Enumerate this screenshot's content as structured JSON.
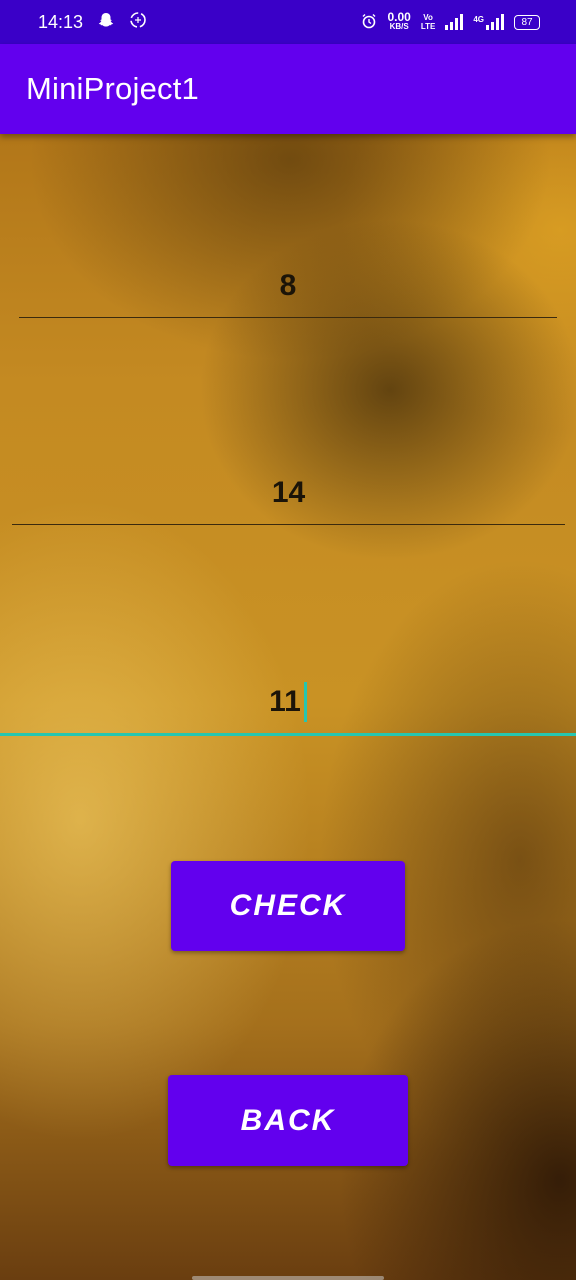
{
  "status_bar": {
    "time": "14:13",
    "speed_value": "0.00",
    "speed_unit": "KB/S",
    "volte_top": "Vo",
    "volte_bottom": "LTE",
    "network": "4G",
    "battery": "87",
    "icons": [
      "snapchat-icon",
      "sync-icon",
      "alarm-icon",
      "signal-icon",
      "battery-icon"
    ]
  },
  "app_bar": {
    "title": "MiniProject1"
  },
  "fields": {
    "first_value": "8",
    "second_value": "14",
    "third_value": "11"
  },
  "buttons": {
    "check_label": "CHECK",
    "back_label": "BACK"
  },
  "colors": {
    "primary": "#6200ee",
    "status_bar": "#3a00c8",
    "accent": "#26c6b0"
  }
}
